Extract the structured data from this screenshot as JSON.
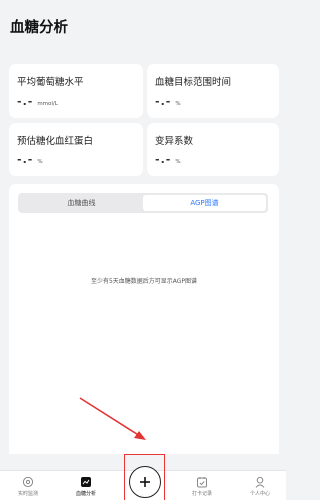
{
  "header": {
    "title": "血糖分析"
  },
  "stats": [
    {
      "label": "平均葡萄糖水平",
      "value": "-.-",
      "unit": "mmol/L"
    },
    {
      "label": "血糖目标范围时间",
      "value": "-.-",
      "unit": "%"
    },
    {
      "label": "预估糖化血红蛋白",
      "value": "-.-",
      "unit": "%"
    },
    {
      "label": "变异系数",
      "value": "-.-",
      "unit": "%"
    }
  ],
  "chart_panel": {
    "tabs": [
      {
        "label": "血糖曲线",
        "active": false
      },
      {
        "label": "AGP图谱",
        "active": true
      }
    ],
    "empty_message": "至少有5天血糖数据后方可显示AGP图谱"
  },
  "bottom_nav": {
    "items": [
      {
        "label": "实时监测",
        "icon": "target-icon"
      },
      {
        "label": "血糖分析",
        "icon": "chart-icon",
        "active": true
      },
      {
        "label": "",
        "icon": "plus-icon"
      },
      {
        "label": "打卡记录",
        "icon": "checkin-icon"
      },
      {
        "label": "个人中心",
        "icon": "person-icon"
      }
    ]
  },
  "colors": {
    "accent": "#2a78ff",
    "annotation": "#e33333",
    "background": "#f2f3f5"
  }
}
